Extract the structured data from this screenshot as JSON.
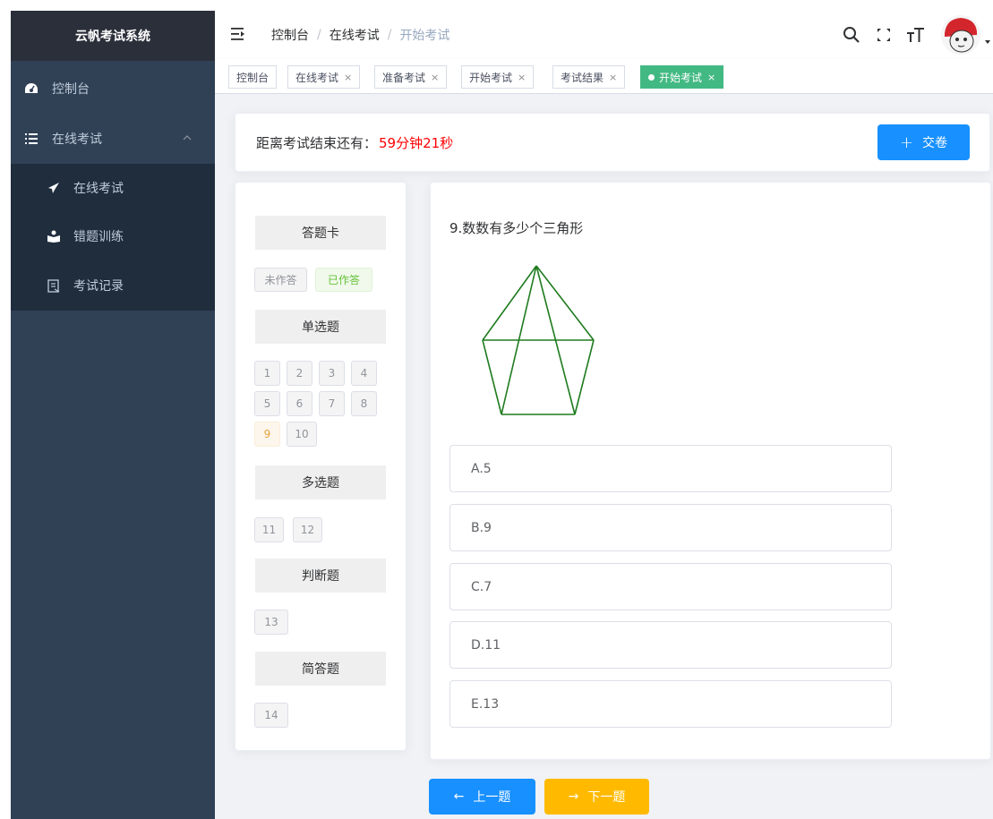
{
  "app": {
    "title": "云帆考试系统"
  },
  "sidebar": {
    "items": [
      {
        "label": "控制台",
        "icon": "dashboard-icon"
      },
      {
        "label": "在线考试",
        "icon": "list-icon",
        "expanded": true,
        "children": [
          {
            "label": "在线考试",
            "icon": "paper-plane-icon"
          },
          {
            "label": "错题训练",
            "icon": "user-training-icon"
          },
          {
            "label": "考试记录",
            "icon": "record-icon"
          }
        ]
      }
    ]
  },
  "navbar": {
    "breadcrumb": [
      "控制台",
      "在线考试",
      "开始考试"
    ],
    "icons": [
      "search-icon",
      "fullscreen-icon",
      "font-size-icon",
      "avatar"
    ]
  },
  "tags": [
    {
      "label": "控制台",
      "closable": false,
      "active": false
    },
    {
      "label": "在线考试",
      "closable": true,
      "active": false
    },
    {
      "label": "准备考试",
      "closable": true,
      "active": false
    },
    {
      "label": "开始考试",
      "closable": true,
      "active": false
    },
    {
      "label": "考试结果",
      "closable": true,
      "active": false
    },
    {
      "label": "开始考试",
      "closable": true,
      "active": true
    }
  ],
  "tag_close": "×",
  "timer": {
    "label": "距离考试结束还有：",
    "value": "59分钟21秒"
  },
  "submit_button": {
    "label": "交卷"
  },
  "answer_card": {
    "title": "答题卡",
    "legend": {
      "unanswered": "未作答",
      "answered": "已作答"
    },
    "groups": [
      {
        "title": "单选题",
        "numbers": [
          "1",
          "2",
          "3",
          "4",
          "5",
          "6",
          "7",
          "8",
          "9",
          "10"
        ]
      },
      {
        "title": "多选题",
        "numbers": [
          "11",
          "12"
        ]
      },
      {
        "title": "判断题",
        "numbers": [
          "13"
        ]
      },
      {
        "title": "简答题",
        "numbers": [
          "14"
        ]
      }
    ],
    "current": "9"
  },
  "question": {
    "title": "9.数数有多少个三角形",
    "figure": "pentagon-triangles-figure",
    "options": [
      "A.5",
      "B.9",
      "C.7",
      "D.11",
      "E.13"
    ]
  },
  "navigation": {
    "prev": "上一题",
    "next": "下一题"
  },
  "colors": {
    "sidebar_bg": "#304156",
    "primary": "#1890ff",
    "warning": "#ffba00",
    "success": "#42b983",
    "timer": "#ff0000"
  }
}
